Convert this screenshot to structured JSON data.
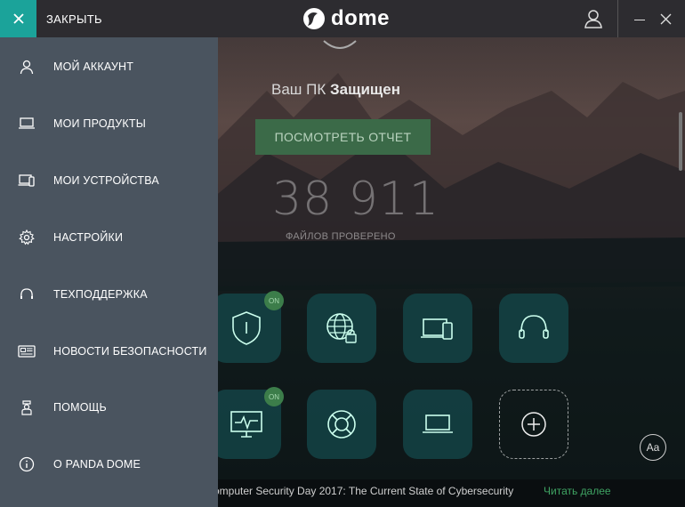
{
  "titlebar": {
    "close_label": "ЗАКРЫТЬ",
    "logo_text": "dome",
    "logo_small": "Panda"
  },
  "main": {
    "status_prefix": "Ваш ПК",
    "status_value": "Защищен",
    "report_button": "ПОСМОТРЕТЬ ОТЧЕТ",
    "files_count": "38 911",
    "files_label": "ФАЙЛОВ ПРОВЕРЕНО",
    "on_badge": "ON",
    "aa_label": "Aa",
    "tiles_row1": [
      "shield-icon",
      "globe-lock-icon",
      "devices-icon",
      "headset-icon"
    ],
    "tiles_row2": [
      "monitor-pulse-icon",
      "lifebuoy-icon",
      "laptop-icon",
      "add-icon"
    ]
  },
  "news": {
    "text": "omputer Security Day 2017: The Current State of Cybersecurity",
    "link": "Читать далее"
  },
  "sidebar": {
    "items": [
      {
        "label": "МОЙ АККАУНТ",
        "icon": "user-icon"
      },
      {
        "label": "МОИ ПРОДУКТЫ",
        "icon": "laptop-icon"
      },
      {
        "label": "МОИ УСТРОЙСТВА",
        "icon": "devices-icon"
      },
      {
        "label": "НАСТРОЙКИ",
        "icon": "gear-icon"
      },
      {
        "label": "ТЕХПОДДЕРЖКА",
        "icon": "headset-icon"
      },
      {
        "label": "НОВОСТИ БЕЗОПАСНОСТИ",
        "icon": "news-icon"
      },
      {
        "label": "ПОМОЩЬ",
        "icon": "help-icon"
      },
      {
        "label": "О PANDA DOME",
        "icon": "info-icon"
      }
    ]
  },
  "colors": {
    "accent": "#1ba39a",
    "sidebar_bg": "#4a545f",
    "report_button_bg": "#3b6a48",
    "link_green": "#3fa463"
  }
}
